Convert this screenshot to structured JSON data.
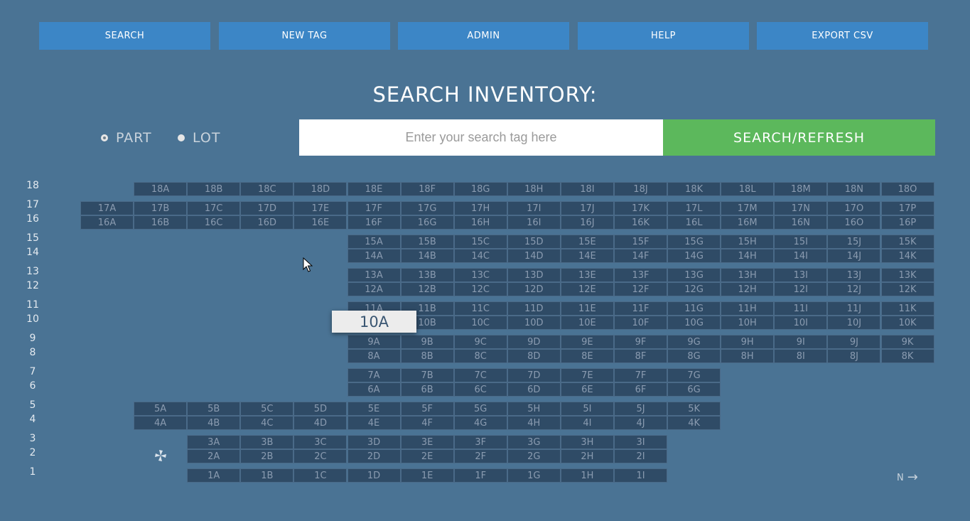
{
  "nav": [
    "SEARCH",
    "NEW TAG",
    "ADMIN",
    "HELP",
    "EXPORT CSV"
  ],
  "title": "SEARCH INVENTORY:",
  "radio": {
    "part": "PART",
    "lot": "LOT",
    "selected": "PART"
  },
  "search": {
    "placeholder": "Enter your search tag here",
    "value": "",
    "button": "SEARCH/REFRESH"
  },
  "compass": {
    "letter": "N",
    "arrow": "→"
  },
  "popup": "10A",
  "icons": {
    "cursor": "mouse-pointer-icon",
    "fan": "pinwheel-icon",
    "north_arrow": "arrow-right-icon"
  },
  "colors": {
    "background": "#4a7394",
    "nav": "#3c86c6",
    "search_button": "#5cb85c",
    "cell": "#2f4b66"
  },
  "rows": [
    {
      "n": "18",
      "cells": [
        "18A",
        "18B",
        "18C",
        "18D",
        "18E",
        "18F",
        "18G",
        "18H",
        "18I",
        "18J",
        "18K",
        "18L",
        "18M",
        "18N",
        "18O"
      ]
    },
    {
      "n": "17",
      "cells": [
        "17A",
        "17B",
        "17C",
        "17D",
        "17E",
        "17F",
        "17G",
        "17H",
        "17I",
        "17J",
        "17K",
        "17L",
        "17M",
        "17N",
        "17O",
        "17P"
      ]
    },
    {
      "n": "16",
      "cells": [
        "16A",
        "16B",
        "16C",
        "16D",
        "16E",
        "16F",
        "16G",
        "16H",
        "16I",
        "16J",
        "16K",
        "16L",
        "16M",
        "16N",
        "16O",
        "16P"
      ]
    },
    {
      "n": "15",
      "cells": [
        "15A",
        "15B",
        "15C",
        "15D",
        "15E",
        "15F",
        "15G",
        "15H",
        "15I",
        "15J",
        "15K"
      ]
    },
    {
      "n": "14",
      "cells": [
        "14A",
        "14B",
        "14C",
        "14D",
        "14E",
        "14F",
        "14G",
        "14H",
        "14I",
        "14J",
        "14K"
      ]
    },
    {
      "n": "13",
      "cells": [
        "13A",
        "13B",
        "13C",
        "13D",
        "13E",
        "13F",
        "13G",
        "13H",
        "13I",
        "13J",
        "13K"
      ]
    },
    {
      "n": "12",
      "cells": [
        "12A",
        "12B",
        "12C",
        "12D",
        "12E",
        "12F",
        "12G",
        "12H",
        "12I",
        "12J",
        "12K"
      ]
    },
    {
      "n": "11",
      "cells": [
        "11A",
        "11B",
        "11C",
        "11D",
        "11E",
        "11F",
        "11G",
        "11H",
        "11I",
        "11J",
        "11K"
      ]
    },
    {
      "n": "10",
      "cells": [
        "10A",
        "10B",
        "10C",
        "10D",
        "10E",
        "10F",
        "10G",
        "10H",
        "10I",
        "10J",
        "10K"
      ]
    },
    {
      "n": "9",
      "cells": [
        "9A",
        "9B",
        "9C",
        "9D",
        "9E",
        "9F",
        "9G",
        "9H",
        "9I",
        "9J",
        "9K"
      ]
    },
    {
      "n": "8",
      "cells": [
        "8A",
        "8B",
        "8C",
        "8D",
        "8E",
        "8F",
        "8G",
        "8H",
        "8I",
        "8J",
        "8K"
      ]
    },
    {
      "n": "7",
      "cells": [
        "7A",
        "7B",
        "7C",
        "7D",
        "7E",
        "7F",
        "7G"
      ]
    },
    {
      "n": "6",
      "cells": [
        "6A",
        "6B",
        "6C",
        "6D",
        "6E",
        "6F",
        "6G"
      ]
    },
    {
      "n": "5",
      "cells": [
        "5A",
        "5B",
        "5C",
        "5D",
        "5E",
        "5F",
        "5G",
        "5H",
        "5I",
        "5J",
        "5K"
      ]
    },
    {
      "n": "4",
      "cells": [
        "4A",
        "4B",
        "4C",
        "4D",
        "4E",
        "4F",
        "4G",
        "4H",
        "4I",
        "4J",
        "4K"
      ]
    },
    {
      "n": "3",
      "cells": [
        "3A",
        "3B",
        "3C",
        "3D",
        "3E",
        "3F",
        "3G",
        "3H",
        "3I"
      ]
    },
    {
      "n": "2",
      "cells": [
        "2A",
        "2B",
        "2C",
        "2D",
        "2E",
        "2F",
        "2G",
        "2H",
        "2I"
      ]
    },
    {
      "n": "1",
      "cells": [
        "1A",
        "1B",
        "1C",
        "1D",
        "1E",
        "1F",
        "1G",
        "1H",
        "1I"
      ]
    }
  ]
}
